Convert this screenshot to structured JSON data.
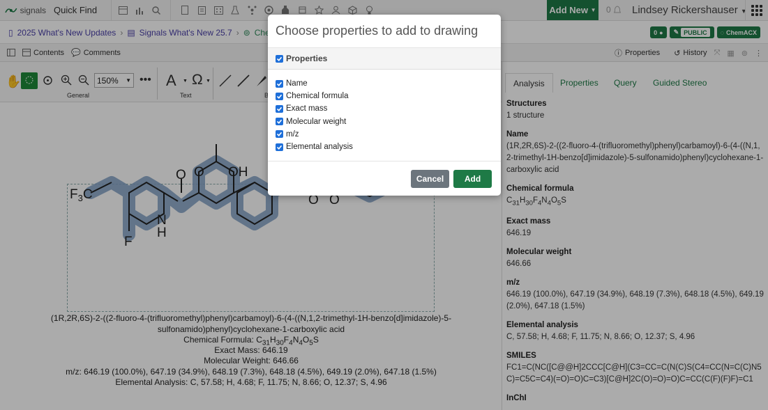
{
  "topbar": {
    "logo_text": "signals",
    "quick_find": "Quick Find",
    "add_new": "Add New",
    "notif_count": "0",
    "user_name": "Lindsey Rickershauser"
  },
  "breadcrumb": {
    "items": [
      "2025 What's New Updates",
      "Signals What's New 25.7",
      "Chem"
    ]
  },
  "badges": {
    "comments_count": "0",
    "public": "PUBLIC",
    "chemacx": "ChemACX"
  },
  "toolbar2": {
    "contents": "Contents",
    "comments": "Comments",
    "properties": "Properties",
    "history": "History"
  },
  "editor": {
    "zoom": "150%",
    "group_general": "General",
    "group_text": "Text",
    "group_b": "B",
    "caption": {
      "name_line1": "(1R,2R,6S)-2-((2-fluoro-4-(trifluoromethyl)phenyl)carbamoyl)-6-(4-((N,1,2-trimethyl-1H-benzo[d]imidazole)-5-",
      "name_line2": "sulfonamido)phenyl)cyclohexane-1-carboxylic acid",
      "formula_label": "Chemical Formula: ",
      "exact": "Exact Mass: 646.19",
      "mw": "Molecular Weight: 646.66",
      "mz": "m/z: 646.19 (100.0%), 647.19 (34.9%), 648.19 (7.3%), 648.18 (4.5%), 649.19 (2.0%), 647.18 (1.5%)",
      "ea": "Elemental Analysis: C, 57.58; H, 4.68; F, 11.75; N, 8.66; O, 12.37; S, 4.96"
    }
  },
  "right_panel": {
    "tabs": [
      "Analysis",
      "Properties",
      "Query",
      "Guided Stereo"
    ],
    "structures_label": "Structures",
    "structures_value": "1 structure",
    "name_label": "Name",
    "name_value": "(1R,2R,6S)-2-((2-fluoro-4-(trifluoromethyl)phenyl)carbamoyl)-6-(4-((N,1,2-trimethyl-1H-benzo[d]imidazole)-5-sulfonamido)phenyl)cyclohexane-1-carboxylic acid",
    "formula_label": "Chemical formula",
    "exact_label": "Exact mass",
    "exact_value": "646.19",
    "mw_label": "Molecular weight",
    "mw_value": "646.66",
    "mz_label": "m/z",
    "mz_value": "646.19 (100.0%), 647.19 (34.9%), 648.19 (7.3%), 648.18 (4.5%), 649.19 (2.0%), 647.18 (1.5%)",
    "ea_label": "Elemental analysis",
    "ea_value": "C, 57.58; H, 4.68; F, 11.75; N, 8.66; O, 12.37; S, 4.96",
    "smiles_label": "SMILES",
    "smiles_value": "FC1=C(NC([C@@H]2CCC[C@H](C3=CC=C(N(C)S(C4=CC(N=C(C)N5C)=C5C=C4)(=O)=O)C=C3)[C@H]2C(O)=O)=O)C=CC(C(F)(F)F)=C1",
    "inchi_label": "InChI"
  },
  "modal": {
    "title": "Choose properties to add to drawing",
    "header": "Properties",
    "options": [
      "Name",
      "Chemical formula",
      "Exact mass",
      "Molecular weight",
      "m/z",
      "Elemental analysis"
    ],
    "cancel": "Cancel",
    "add": "Add"
  }
}
